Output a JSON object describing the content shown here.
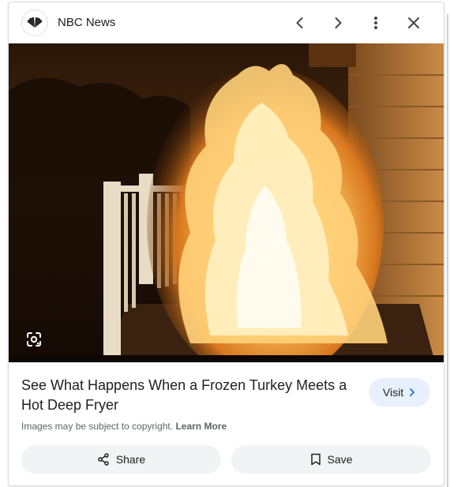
{
  "header": {
    "source_name": "NBC News",
    "icons": [
      "nbc-peacock-logo",
      "chevron-left-icon",
      "chevron-right-icon",
      "more-vert-icon",
      "close-icon"
    ]
  },
  "image": {
    "description_icon": "google-lens-icon"
  },
  "result": {
    "title": "See What Happens When a Frozen Turkey Meets a Hot Deep Fryer",
    "visit_label": "Visit",
    "copyright_text": "Images may be subject to copyright.",
    "learn_more_label": "Learn More"
  },
  "actions": {
    "share_label": "Share",
    "save_label": "Save"
  },
  "colors": {
    "visit_bg": "#e8f0fe",
    "action_bg": "#f1f3f4",
    "text": "#202124",
    "muted": "#5f6368"
  }
}
